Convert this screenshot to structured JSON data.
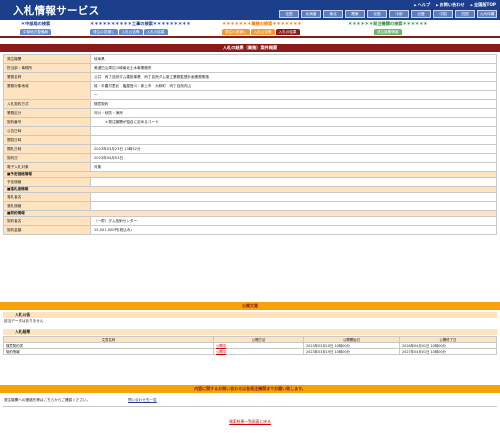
{
  "header": {
    "title": "入札情報サービス",
    "links": [
      "ヘルプ",
      "お問い合わせ",
      "全国版TOP"
    ],
    "regions": [
      "全国",
      "北海道",
      "東北",
      "関東",
      "北陸",
      "中部",
      "近畿",
      "中国",
      "四国",
      "九州沖縄"
    ]
  },
  "nav": {
    "groups": [
      {
        "title": "＊中部局の検索",
        "tabs": [
          "中部地方整備局"
        ]
      },
      {
        "title": "＊＊＊＊＊＊＊＊＊＊工事の検索＊＊＊＊＊＊＊＊＊",
        "tabs": [
          "発注の見通し",
          "入札公告等",
          "入札の結果"
        ]
      },
      {
        "title": "＊＊＊＊＊＊＊業務の検索＊＊＊＊＊＊＊",
        "tabs": [
          "発注の見通し",
          "入札公告等",
          "入札の結果"
        ]
      },
      {
        "title": "＊＊＊＊＊＊発注機関の検索＊＊＊＊＊＊",
        "tabs": [
          "発注機関情報"
        ]
      }
    ]
  },
  "page": {
    "section_title": "入札の結果（業務）案件概要",
    "back_link": "検索結果一覧画面に戻る"
  },
  "detail": {
    "rows": [
      {
        "key": "発注機関",
        "value": "岐阜県"
      },
      {
        "key": "担当部・事務所",
        "value": "美濃白山周辺川崎南北土木事業務所"
      },
      {
        "key": "業務名称",
        "value": "公共　丙丁自然ダム建設事業　丙丁自然ダム施工業務監督計画業務策施"
      },
      {
        "key": "業務対象地域",
        "value": "岐・半農付里北　亀屋島川・新上市　大和町　丙丁自然内山"
      },
      {
        "key": "",
        "value": "一"
      },
      {
        "key": "入札契約方式",
        "value": "随意契約"
      },
      {
        "key": "業務区分",
        "value": "河川・砂防・海岸"
      },
      {
        "key": "契約番号",
        "value": "　　　＊発注機関が独自に定めるコード"
      },
      {
        "key": "公告日時",
        "value": ""
      },
      {
        "key": "閲覧日時",
        "value": ""
      },
      {
        "key": "開札日時",
        "value": "2023年03月23日 13時52分"
      },
      {
        "key": "契約日",
        "value": "2023年04月03日"
      },
      {
        "key": "電子入札対象",
        "value": "対象"
      }
    ],
    "price_title": "■予定価格情報",
    "price_rows": [
      {
        "key": "予定価格",
        "value": ""
      }
    ],
    "bid_title": "■落札者情報",
    "bid_rows": [
      {
        "key": "落札者名",
        "value": ""
      },
      {
        "key": "落札価格",
        "value": ""
      }
    ],
    "contract_title": "■契約情報",
    "contract_rows": [
      {
        "key": "契約者名",
        "value": "（一財）ダム技術センター"
      },
      {
        "key": "契約金額",
        "value": "15,501,000円(税込み)"
      }
    ]
  },
  "docs": {
    "band": "公開文書",
    "notice_header": "入札公告",
    "notice_empty": "該当データはありません",
    "results_header": "入札結果",
    "columns": [
      "文書名称",
      "公開方法",
      "公開開始日",
      "公開終了日"
    ],
    "rows": [
      {
        "name": "随意契約書",
        "method": "公開中",
        "start": "2023年03月19日 10時00分",
        "end": "2026年04月01日 10時00分"
      },
      {
        "name": "契約情報",
        "method": "公開中",
        "start": "2023年03月19日 10時00分",
        "end": "2027年04月01日 10時00分"
      }
    ]
  },
  "contact": {
    "band": "内容に関するお問い合わせは各発注機関までお願い致します。",
    "text": "発注機関への連絡先等はこちらからご確認ください。",
    "link": "問い合わせ先一覧"
  }
}
